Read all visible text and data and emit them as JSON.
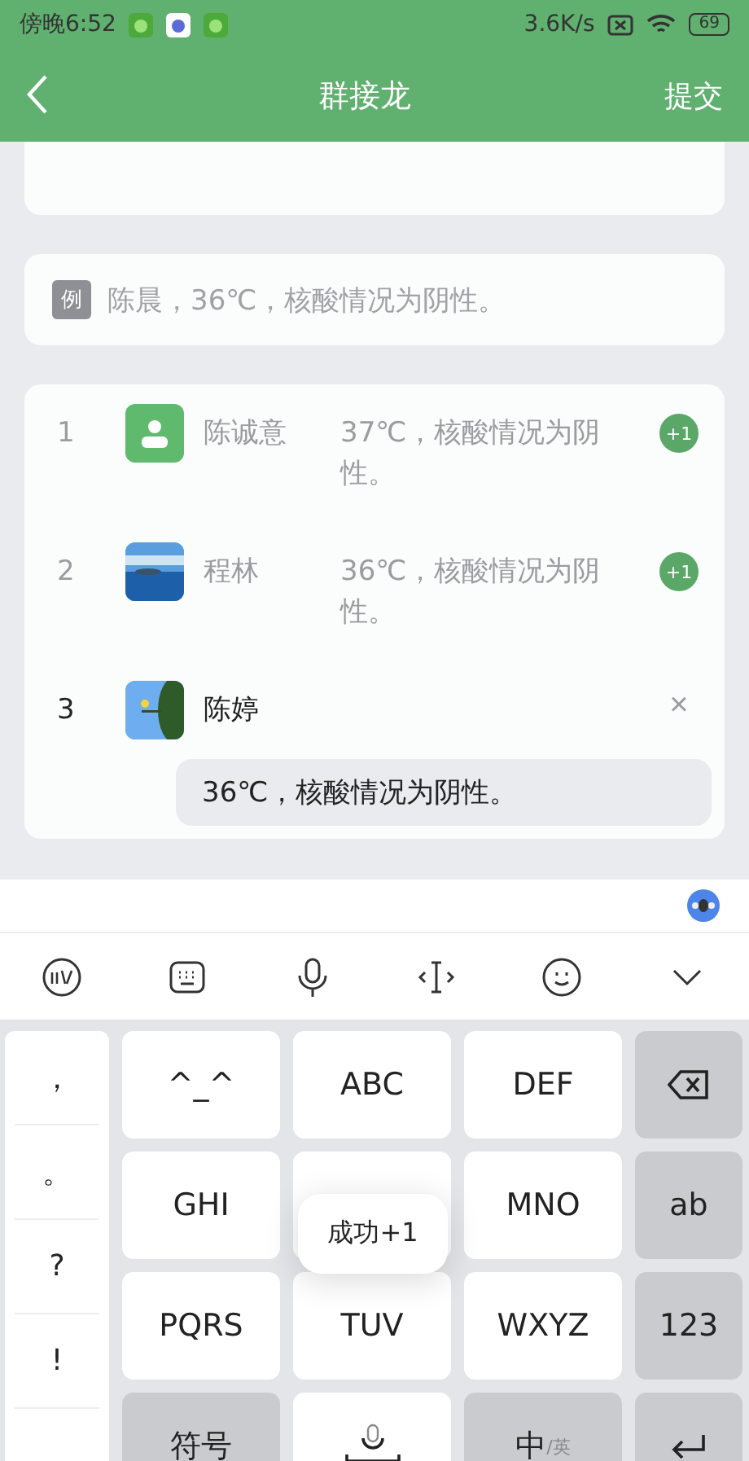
{
  "status_bar": {
    "time": "傍晚6:52",
    "speed": "3.6K/s",
    "battery": "69"
  },
  "nav": {
    "title": "群接龙",
    "action": "提交"
  },
  "example": {
    "tag": "例",
    "text": "陈晨，36℃，核酸情况为阴性。"
  },
  "entries": [
    {
      "index": "1",
      "avatar": {
        "kind": "contact"
      },
      "name": "陈诚意",
      "text": "37℃，核酸情况为阴性。",
      "editing": false,
      "badge": "+1"
    },
    {
      "index": "2",
      "name": "程林",
      "text": "36℃，核酸情况为阴性。",
      "editing": false,
      "badge": "+1"
    },
    {
      "index": "3",
      "name": "陈婷",
      "value": "36℃，核酸情况为阴性。",
      "editing": true,
      "close": "×"
    }
  ],
  "keyboard": {
    "side_keys": [
      "，",
      "。",
      "?",
      "!"
    ],
    "keys": [
      {
        "kind": "letter",
        "label": "^_^"
      },
      {
        "kind": "letter",
        "label": "ABC"
      },
      {
        "kind": "letter",
        "label": "DEF"
      },
      {
        "kind": "backspace"
      },
      {
        "kind": "letter",
        "label": "GHI"
      },
      {
        "kind": "hidden"
      },
      {
        "kind": "letter",
        "label": "MNO"
      },
      {
        "kind": "function",
        "label": "ab"
      },
      {
        "kind": "letter",
        "label": "PQRS"
      },
      {
        "kind": "letter",
        "label": "TUV"
      },
      {
        "kind": "letter",
        "label": "WXYZ"
      },
      {
        "kind": "function",
        "label": "123"
      },
      {
        "kind": "function",
        "label": "符号"
      },
      {
        "kind": "space"
      },
      {
        "kind": "function",
        "label": "中",
        "sub": "/英"
      },
      {
        "kind": "enter"
      }
    ]
  },
  "toast": "成功+1"
}
